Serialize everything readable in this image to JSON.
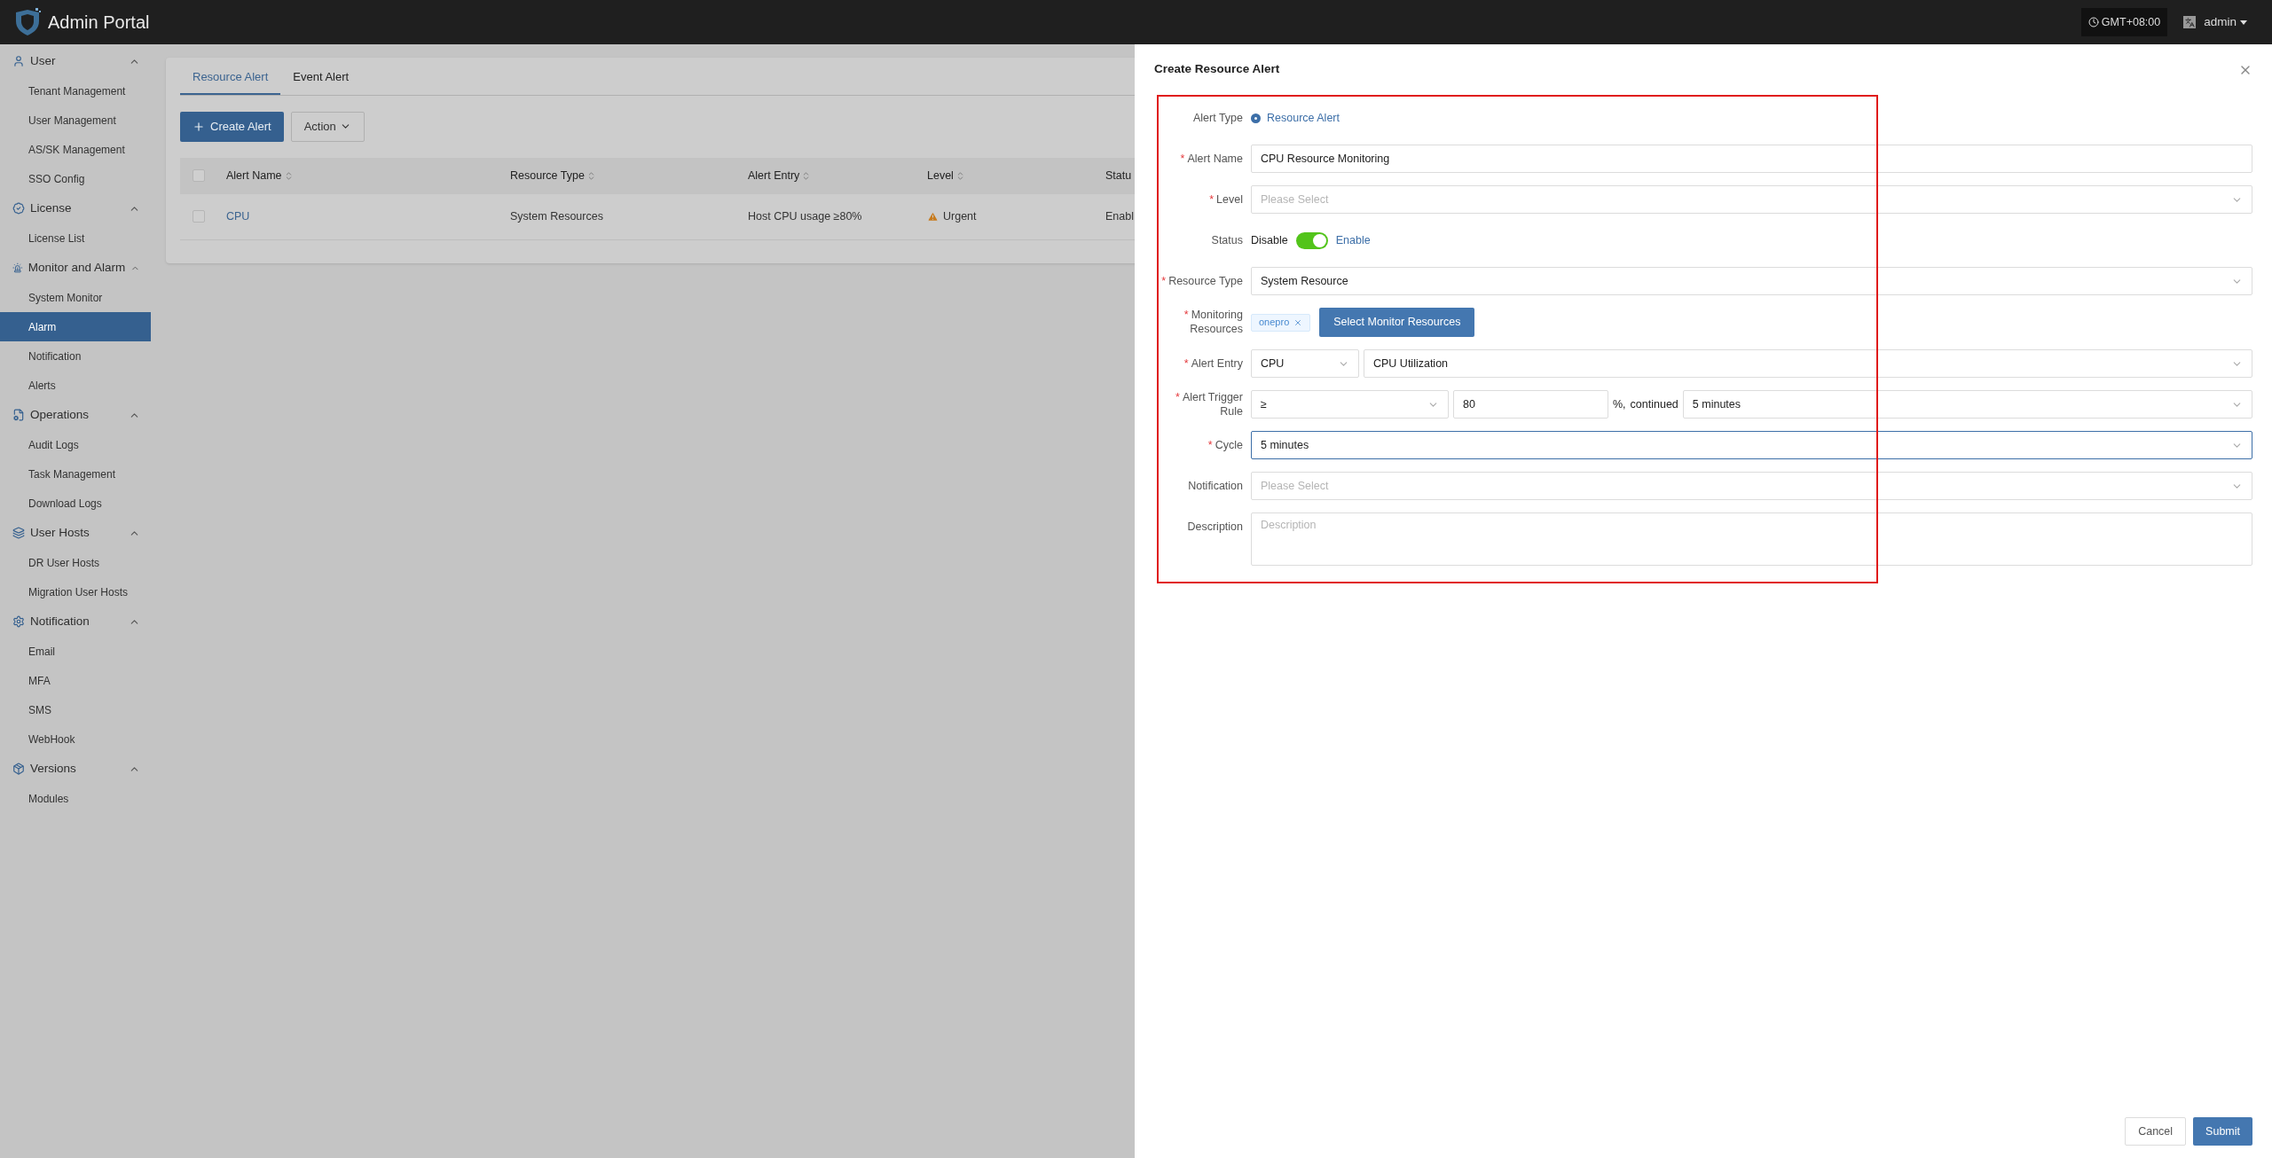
{
  "topbar": {
    "title": "Admin Portal",
    "timezone": "GMT+08:00",
    "user": "admin"
  },
  "sidebar": {
    "groups": [
      {
        "label": "User",
        "expanded": true,
        "items": [
          {
            "label": "Tenant Management",
            "selected": false
          },
          {
            "label": "User Management",
            "selected": false
          },
          {
            "label": "AS/SK Management",
            "selected": false
          },
          {
            "label": "SSO Config",
            "selected": false
          }
        ]
      },
      {
        "label": "License",
        "expanded": true,
        "items": [
          {
            "label": "License List",
            "selected": false
          }
        ]
      },
      {
        "label": "Monitor and Alarm",
        "expanded": true,
        "items": [
          {
            "label": "System Monitor",
            "selected": false
          },
          {
            "label": "Alarm",
            "selected": true
          },
          {
            "label": "Notification",
            "selected": false
          },
          {
            "label": "Alerts",
            "selected": false
          }
        ]
      },
      {
        "label": "Operations",
        "expanded": true,
        "items": [
          {
            "label": "Audit Logs",
            "selected": false
          },
          {
            "label": "Task Management",
            "selected": false
          },
          {
            "label": "Download Logs",
            "selected": false
          }
        ]
      },
      {
        "label": "User Hosts",
        "expanded": true,
        "items": [
          {
            "label": "DR User Hosts",
            "selected": false
          },
          {
            "label": "Migration User Hosts",
            "selected": false
          }
        ]
      },
      {
        "label": "Notification",
        "expanded": true,
        "items": [
          {
            "label": "Email",
            "selected": false
          },
          {
            "label": "MFA",
            "selected": false
          },
          {
            "label": "SMS",
            "selected": false
          },
          {
            "label": "WebHook",
            "selected": false
          }
        ]
      },
      {
        "label": "Versions",
        "expanded": true,
        "items": [
          {
            "label": "Modules",
            "selected": false
          }
        ]
      }
    ]
  },
  "tabs": [
    {
      "label": "Resource Alert",
      "selected": true
    },
    {
      "label": "Event Alert",
      "selected": false
    }
  ],
  "toolbar": {
    "create": "Create Alert",
    "action": "Action"
  },
  "table": {
    "columns": [
      "Alert Name",
      "Resource Type",
      "Alert Entry",
      "Level",
      "Statu"
    ],
    "all_checked": false,
    "rows": [
      {
        "checked": false,
        "cells": [
          "CPU",
          "System Resources",
          "Host CPU usage ≥80%",
          "Urgent",
          "Enabl"
        ]
      }
    ]
  },
  "drawer": {
    "title": "Create Resource Alert",
    "fields": [
      {
        "kind": "radio",
        "label": "Alert Type",
        "options": [
          {
            "label": "Resource Alert",
            "selected": true
          }
        ]
      },
      {
        "kind": "controls",
        "label": "Alert Name",
        "mark": "*",
        "controls": [
          {
            "kind": "input",
            "value": "CPU Resource Monitoring",
            "focused": false
          }
        ]
      },
      {
        "kind": "controls",
        "label": "Level",
        "mark": "*",
        "controls": [
          {
            "kind": "select",
            "placeholder": "Please Select",
            "focused": false
          }
        ]
      },
      {
        "kind": "switch",
        "label": "Status",
        "off_label": "Disable",
        "on_label": "Enable",
        "on": true
      },
      {
        "kind": "controls",
        "label": "Resource Type",
        "mark": "*",
        "controls": [
          {
            "kind": "select",
            "value": "System Resource",
            "focused": false
          }
        ]
      },
      {
        "kind": "tags",
        "label": "Monitoring Resources",
        "mark": "*",
        "tags": [
          "onepro"
        ],
        "button": "Select Monitor Resources"
      },
      {
        "kind": "controls",
        "label": "Alert Entry",
        "mark": "*",
        "controls": [
          {
            "kind": "select",
            "value": "CPU",
            "focused": false
          },
          {
            "kind": "select",
            "value": "CPU Utilization",
            "focused": false
          }
        ]
      },
      {
        "kind": "controls",
        "label": "Alert Trigger Rule",
        "mark": "*",
        "controls": [
          {
            "kind": "select",
            "value": "≥",
            "focused": false
          },
          {
            "kind": "input",
            "value": "80",
            "focused": false
          },
          {
            "kind": "text",
            "value": "%,"
          },
          {
            "kind": "text",
            "value": "continued"
          },
          {
            "kind": "select",
            "value": "5 minutes",
            "focused": false
          }
        ]
      },
      {
        "kind": "controls",
        "label": "Cycle",
        "mark": "*",
        "controls": [
          {
            "kind": "select",
            "value": "5 minutes",
            "focused": true
          }
        ]
      },
      {
        "kind": "controls",
        "label": "Notification",
        "controls": [
          {
            "kind": "select",
            "placeholder": "Please Select",
            "focused": false
          }
        ]
      },
      {
        "kind": "textarea",
        "label": "Description",
        "placeholder": "Description"
      }
    ],
    "buttons": [
      {
        "label": "Cancel",
        "kind": "secondary"
      },
      {
        "label": "Submit",
        "kind": "primary"
      }
    ]
  }
}
